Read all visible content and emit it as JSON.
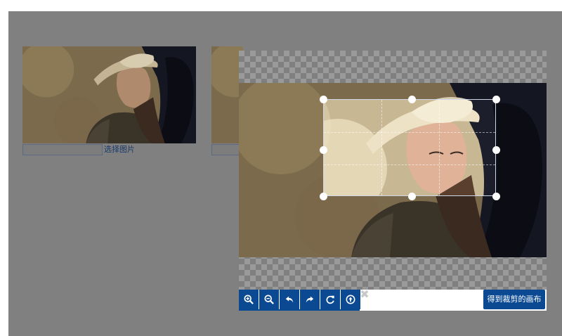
{
  "thumbnails": {
    "select_label": "选择图片"
  },
  "cropper": {
    "ratio_guides": "dashed",
    "toolbar": {
      "buttons": [
        {
          "name": "zoom-in",
          "icon": "zoom-in-icon"
        },
        {
          "name": "zoom-out",
          "icon": "zoom-out-icon"
        },
        {
          "name": "rotate-left",
          "icon": "arrow-left-icon"
        },
        {
          "name": "rotate-right",
          "icon": "arrow-right-icon"
        },
        {
          "name": "reset",
          "icon": "refresh-icon"
        },
        {
          "name": "upload",
          "icon": "upload-circle-icon"
        }
      ],
      "close_symbol": "✖",
      "get_canvas_label": "得到裁剪的画布"
    }
  },
  "colors": {
    "overlay": "#808080",
    "toolbar_blue": "#0b4a93"
  }
}
